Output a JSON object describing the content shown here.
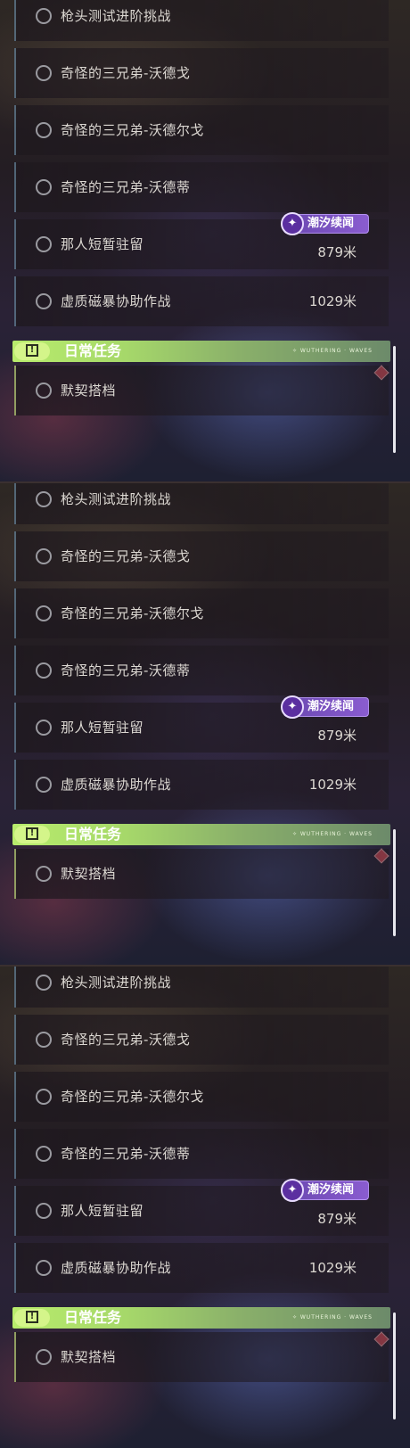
{
  "panels": [
    {
      "tasks": [
        {
          "label": "枪头测试进阶挑战",
          "distance": ""
        },
        {
          "label": "奇怪的三兄弟-沃德戈",
          "distance": ""
        },
        {
          "label": "奇怪的三兄弟-沃德尔戈",
          "distance": ""
        },
        {
          "label": "奇怪的三兄弟-沃德蒂",
          "distance": ""
        },
        {
          "label": "那人短暂驻留",
          "distance": "879米",
          "tag": "潮汐续闻"
        },
        {
          "label": "虚质磁暴协助作战",
          "distance": "1029米"
        }
      ],
      "section_title": "日常任务",
      "section_deco": "✧ WUTHERING · WAVES",
      "daily_task": "默契搭档"
    },
    {
      "tasks": [
        {
          "label": "枪头测试进阶挑战",
          "distance": ""
        },
        {
          "label": "奇怪的三兄弟-沃德戈",
          "distance": ""
        },
        {
          "label": "奇怪的三兄弟-沃德尔戈",
          "distance": ""
        },
        {
          "label": "奇怪的三兄弟-沃德蒂",
          "distance": ""
        },
        {
          "label": "那人短暂驻留",
          "distance": "879米",
          "tag": "潮汐续闻"
        },
        {
          "label": "虚质磁暴协助作战",
          "distance": "1029米"
        }
      ],
      "section_title": "日常任务",
      "section_deco": "✧ WUTHERING · WAVES",
      "daily_task": "默契搭档"
    },
    {
      "tasks": [
        {
          "label": "枪头测试进阶挑战",
          "distance": ""
        },
        {
          "label": "奇怪的三兄弟-沃德戈",
          "distance": ""
        },
        {
          "label": "奇怪的三兄弟-沃德尔戈",
          "distance": ""
        },
        {
          "label": "奇怪的三兄弟-沃德蒂",
          "distance": ""
        },
        {
          "label": "那人短暂驻留",
          "distance": "879米",
          "tag": "潮汐续闻"
        },
        {
          "label": "虚质磁暴协助作战",
          "distance": "1029米"
        }
      ],
      "section_title": "日常任务",
      "section_deco": "✧ WUTHERING · WAVES",
      "daily_task": "默契搭档"
    }
  ],
  "icons": {
    "task_status": "circle-outline-icon",
    "section": "exclamation-box-icon",
    "tag": "sparkle-star-icon",
    "alert": "red-diamond-icon"
  },
  "colors": {
    "section_green": "#b8ec6c",
    "tag_purple": "#7a52c4",
    "alert_red": "#d85060"
  }
}
